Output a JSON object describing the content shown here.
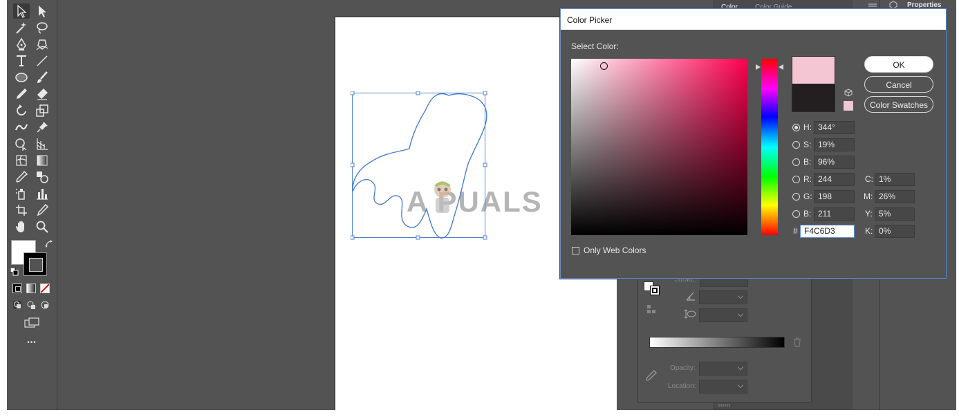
{
  "panels": {
    "tab_color": "Color",
    "tab_color_guide": "Color Guide",
    "properties_label": "Properties",
    "gradient": {
      "stroke_label": "Stroke:",
      "opacity_label": "Opacity:",
      "location_label": "Location:"
    }
  },
  "watermark": {
    "text": "A PUALS"
  },
  "dialog": {
    "title": "Color Picker",
    "select_color_label": "Select Color:",
    "only_web_colors_label": "Only Web Colors",
    "ok_label": "OK",
    "cancel_label": "Cancel",
    "swatches_label": "Color Swatches",
    "new_color": "#F4C6D3",
    "old_color": "#231F20",
    "hue_base_color": "#ff0050",
    "fields": {
      "H": {
        "label": "H:",
        "value": "344°",
        "selected": true
      },
      "S": {
        "label": "S:",
        "value": "19%"
      },
      "B": {
        "label": "B:",
        "value": "96%"
      },
      "R": {
        "label": "R:",
        "value": "244"
      },
      "G": {
        "label": "G:",
        "value": "198"
      },
      "Bl": {
        "label": "B:",
        "value": "211"
      },
      "C": {
        "label": "C:",
        "value": "1%"
      },
      "M": {
        "label": "M:",
        "value": "26%"
      },
      "Y": {
        "label": "Y:",
        "value": "5%"
      },
      "K": {
        "label": "K:",
        "value": "0%"
      },
      "hex_label": "#",
      "hex_value": "F4C6D3"
    }
  },
  "toolbar": {
    "more_label": "•••",
    "tools": [
      "selection-tool-icon",
      "direct-selection-tool-icon",
      "magic-wand-tool-icon",
      "lasso-tool-icon",
      "pen-tool-icon",
      "curvature-tool-icon",
      "type-tool-icon",
      "line-segment-tool-icon",
      "ellipse-tool-icon",
      "paintbrush-tool-icon",
      "pencil-tool-icon",
      "eraser-tool-icon",
      "rotate-tool-icon",
      "scale-tool-icon",
      "width-tool-icon",
      "puppet-warp-tool-icon",
      "shape-builder-tool-icon",
      "perspective-grid-tool-icon",
      "mesh-tool-icon",
      "gradient-tool-icon",
      "eyedropper-tool-icon",
      "blend-tool-icon",
      "symbol-sprayer-tool-icon",
      "column-graph-tool-icon",
      "artboard-tool-icon",
      "slice-tool-icon",
      "hand-tool-icon",
      "zoom-tool-icon"
    ]
  }
}
